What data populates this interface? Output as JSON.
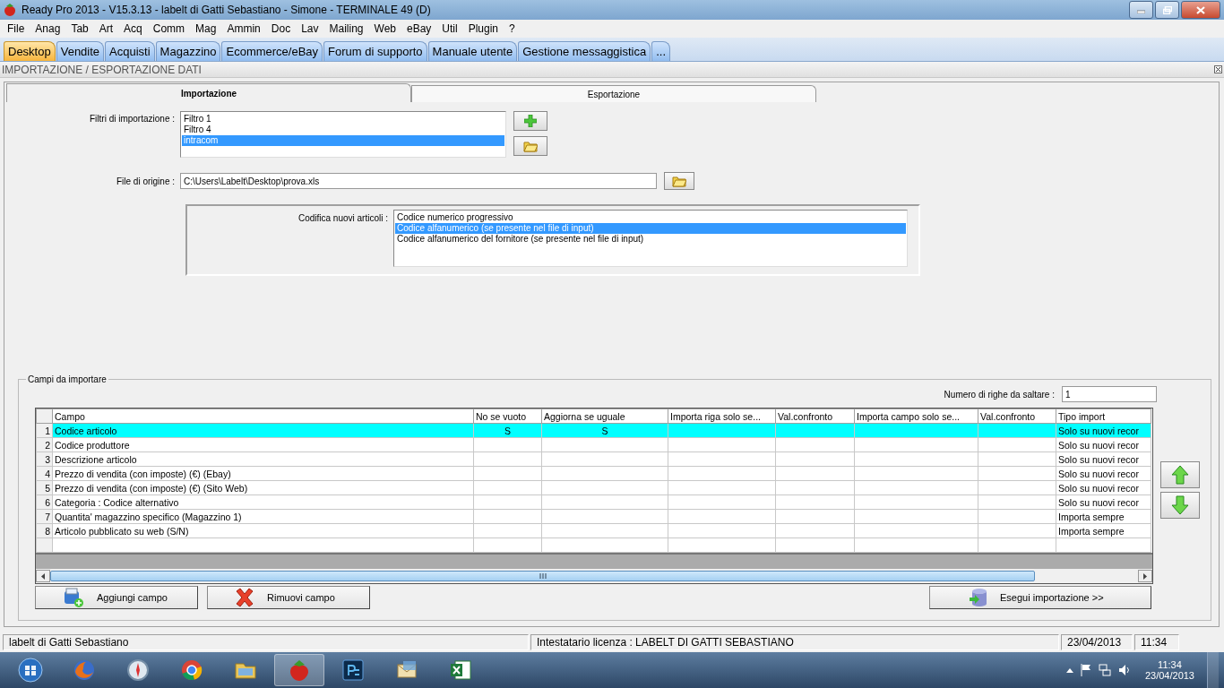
{
  "window": {
    "title": "Ready Pro 2013 - V15.3.13 - labelt di Gatti Sebastiano - Simone - TERMINALE 49 (D)"
  },
  "menu": [
    "File",
    "Anag",
    "Tab",
    "Art",
    "Acq",
    "Comm",
    "Mag",
    "Ammin",
    "Doc",
    "Lav",
    "Mailing",
    "Web",
    "eBay",
    "Util",
    "Plugin",
    "?"
  ],
  "doc_tabs": [
    {
      "label": "Desktop",
      "selected": true
    },
    {
      "label": "Vendite",
      "selected": false
    },
    {
      "label": "Acquisti",
      "selected": false
    },
    {
      "label": "Magazzino",
      "selected": false
    },
    {
      "label": "Ecommerce/eBay",
      "selected": false
    },
    {
      "label": "Forum di supporto",
      "selected": false
    },
    {
      "label": "Manuale utente",
      "selected": false
    },
    {
      "label": "Gestione messaggistica",
      "selected": false
    },
    {
      "label": "...",
      "selected": false
    }
  ],
  "section_title": "IMPORTAZIONE / ESPORTAZIONE DATI",
  "tabs": [
    {
      "label": "Importazione",
      "selected": true
    },
    {
      "label": "Esportazione",
      "selected": false
    }
  ],
  "filters": {
    "label": "Filtri di importazione :",
    "items": [
      {
        "label": "Filtro 1",
        "selected": false
      },
      {
        "label": "Filtro 4",
        "selected": false
      },
      {
        "label": "intracom",
        "selected": true
      }
    ]
  },
  "source_file": {
    "label": "File di origine :",
    "value": "C:\\Users\\Labelt\\Desktop\\prova.xls"
  },
  "coding": {
    "label": "Codifica nuovi articoli :",
    "items": [
      {
        "label": "Codice numerico progressivo",
        "selected": false
      },
      {
        "label": "Codice alfanumerico (se presente nel file di input)",
        "selected": true
      },
      {
        "label": "Codice alfanumerico del fornitore (se presente nel file di input)",
        "selected": false
      }
    ]
  },
  "fields_group": {
    "title": "Campi da importare",
    "skip_label": "Numero di righe da saltare  :",
    "skip_value": "1"
  },
  "table": {
    "columns": [
      "Campo",
      "No se vuoto",
      "Aggiorna se uguale",
      "Importa riga solo se...",
      "Val.confronto",
      "Importa campo solo se...",
      "Val.confronto",
      "Tipo import"
    ],
    "rows": [
      {
        "number": "1",
        "selected": true,
        "cells": [
          "Codice articolo",
          "S",
          "S",
          "",
          "",
          "",
          "",
          "Solo su nuovi recor"
        ]
      },
      {
        "number": "2",
        "selected": false,
        "cells": [
          "Codice produttore",
          "",
          "",
          "",
          "",
          "",
          "",
          "Solo su nuovi recor"
        ]
      },
      {
        "number": "3",
        "selected": false,
        "cells": [
          "Descrizione articolo",
          "",
          "",
          "",
          "",
          "",
          "",
          "Solo su nuovi recor"
        ]
      },
      {
        "number": "4",
        "selected": false,
        "cells": [
          "Prezzo di vendita (con imposte) (€) (Ebay)",
          "",
          "",
          "",
          "",
          "",
          "",
          "Solo su nuovi recor"
        ]
      },
      {
        "number": "5",
        "selected": false,
        "cells": [
          "Prezzo di vendita (con imposte) (€) (Sito Web)",
          "",
          "",
          "",
          "",
          "",
          "",
          "Solo su nuovi recor"
        ]
      },
      {
        "number": "6",
        "selected": false,
        "cells": [
          "Categoria : Codice alternativo",
          "",
          "",
          "",
          "",
          "",
          "",
          "Solo su nuovi recor"
        ]
      },
      {
        "number": "7",
        "selected": false,
        "cells": [
          "Quantita' magazzino specifico (Magazzino 1)",
          "",
          "",
          "",
          "",
          "",
          "",
          "Importa sempre"
        ]
      },
      {
        "number": "8",
        "selected": false,
        "cells": [
          "Articolo pubblicato su web (S/N)",
          "",
          "",
          "",
          "",
          "",
          "",
          "Importa sempre"
        ]
      }
    ]
  },
  "buttons": {
    "add": "Aggiungi campo",
    "remove": "Rimuovi campo",
    "run": "Esegui importazione >>"
  },
  "status_bar": {
    "user": "labelt di Gatti Sebastiano",
    "license": "Intestatario licenza : LABELT DI GATTI SEBASTIANO",
    "date": "23/04/2013",
    "time": "11:34"
  },
  "taskbar": {
    "clock_time": "11:34",
    "clock_date": "23/04/2013"
  }
}
